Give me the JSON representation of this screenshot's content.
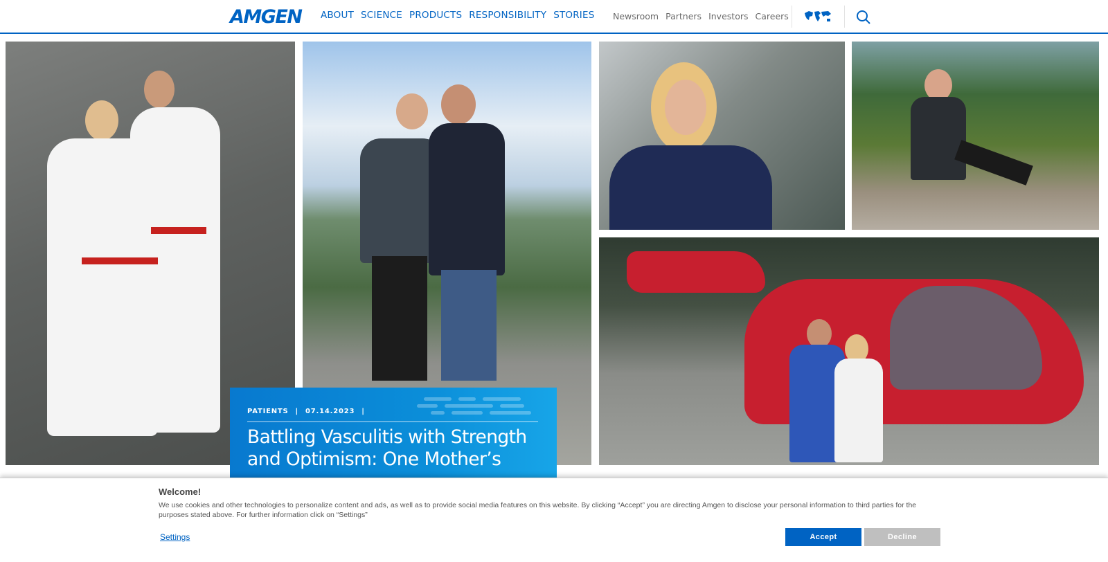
{
  "header": {
    "logo": "AMGEN",
    "main_nav": [
      "ABOUT",
      "SCIENCE",
      "PRODUCTS",
      "RESPONSIBILITY",
      "STORIES"
    ],
    "util_nav": [
      "Newsroom",
      "Partners",
      "Investors",
      "Careers"
    ],
    "icons": [
      "world-map-icon",
      "search-icon"
    ]
  },
  "article": {
    "category": "PATIENTS",
    "separator": "|",
    "date": "07.14.2023",
    "title": "Battling Vasculitis with Strength and Optimism: One Mother’s"
  },
  "cookie": {
    "title": "Welcome!",
    "text": "We use cookies and other technologies to personalize content and ads, as well as to provide social media features on this website. By clicking “Accept” you are directing Amgen to disclose your personal information to third parties for the purposes stated above. For further information click on “Settings”",
    "settings_label": "Settings",
    "accept_label": "Accept",
    "decline_label": "Decline"
  },
  "colors": {
    "brand_blue": "#0063c3",
    "card_blue": "#0b8ed9",
    "decline_gray": "#bfbfbf"
  }
}
